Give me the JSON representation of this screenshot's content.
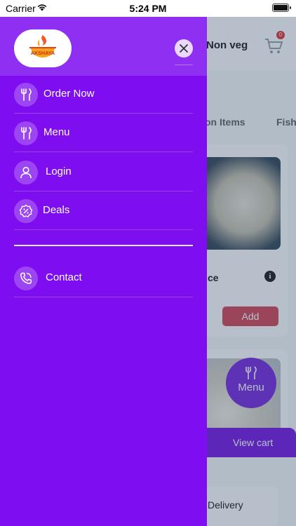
{
  "status_bar": {
    "carrier": "Carrier",
    "time": "5:24 PM",
    "wifi_icon": "wifi-icon",
    "battery_icon": "battery-icon"
  },
  "background_screen": {
    "header_title": "Non veg",
    "cart_badge": "0",
    "tabs": [
      "on Items",
      "Fish"
    ],
    "item_name": "ce",
    "info_icon": "i",
    "add_label": "Add",
    "menu_fab_label": "Menu",
    "view_cart_label": "View cart",
    "delivery_label": "Delivery"
  },
  "drawer": {
    "logo_text": "AKSHAYA",
    "close_icon": "close-icon",
    "items": [
      {
        "label": "Order Now",
        "icon": "cutlery-icon"
      },
      {
        "label": "Menu",
        "icon": "cutlery-icon"
      },
      {
        "label": "Login",
        "icon": "user-icon"
      },
      {
        "label": "Deals",
        "icon": "percent-badge-icon"
      },
      {
        "label": "Contact",
        "icon": "phone-icon"
      }
    ]
  },
  "colors": {
    "drawer_bg": "#7e0df0",
    "drawer_header_bg": "#8f2ff2",
    "view_cart_bg": "#7a1ee6",
    "add_button_bg": "#d64a5a"
  }
}
